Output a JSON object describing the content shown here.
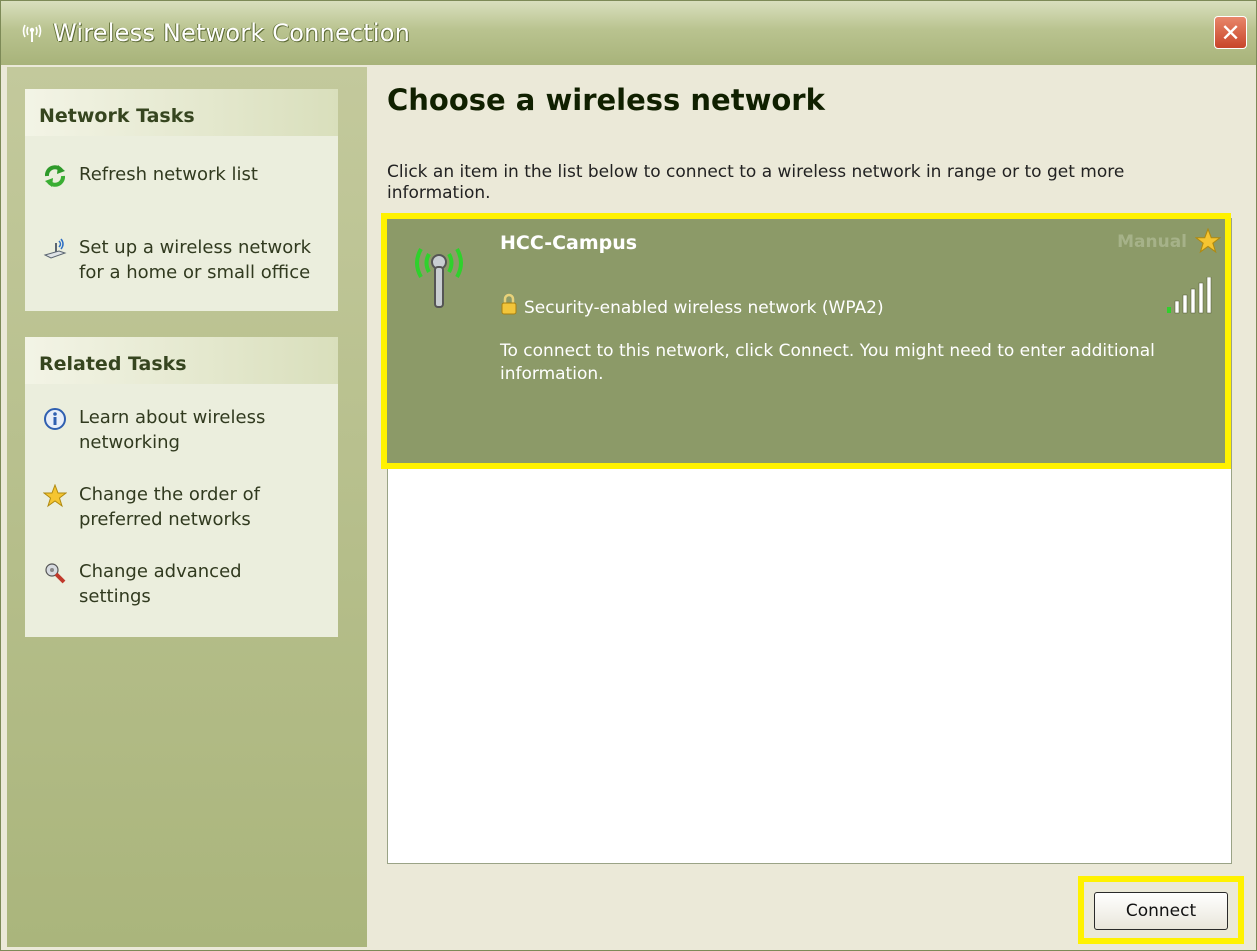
{
  "window": {
    "title": "Wireless Network Connection",
    "close_label": "✕"
  },
  "network_tasks": {
    "header": "Network Tasks",
    "items": [
      {
        "label": "Refresh network list",
        "icon": "refresh-icon"
      },
      {
        "label": "Set up a wireless network for a home or small office",
        "icon": "setup-network-icon"
      }
    ]
  },
  "related_tasks": {
    "header": "Related Tasks",
    "items": [
      {
        "label": "Learn about wireless networking",
        "icon": "info-icon"
      },
      {
        "label": "Change the order of preferred networks",
        "icon": "star-icon"
      },
      {
        "label": "Change advanced settings",
        "icon": "settings-icon"
      }
    ]
  },
  "main": {
    "heading": "Choose a wireless network",
    "instructions": "Click an item in the list below to connect to a wireless network in range or to get more information."
  },
  "network": {
    "name": "HCC-Campus",
    "mode": "Manual",
    "security": "Security-enabled wireless network (WPA2)",
    "description": "To connect to this network, click Connect. You might need to enter additional information.",
    "signal_bars": 5,
    "signal_max": 5
  },
  "buttons": {
    "connect": "Connect"
  },
  "colors": {
    "highlight": "#fff200",
    "selected_item": "#8c9a68",
    "accent_green": "#2e9a2a"
  }
}
